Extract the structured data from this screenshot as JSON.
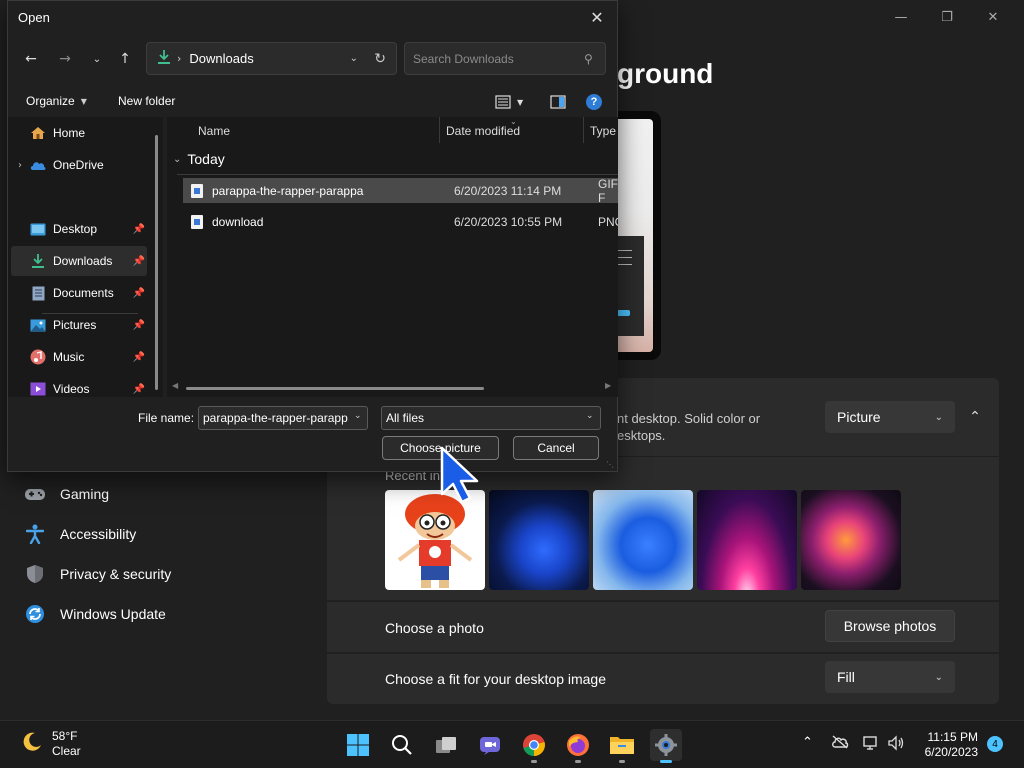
{
  "settings": {
    "title_fragment": "ground",
    "background_desc": "nt desktop. Solid color or\nesktops.",
    "personalize_type": "Picture",
    "recent_label": "Recent in",
    "photo_row_label": "Choose a photo",
    "browse_label": "Browse photos",
    "fit_row_label": "Choose a fit for your desktop image",
    "fit_value": "Fill",
    "nav": [
      {
        "label": "Gaming",
        "icon": "gaming-icon"
      },
      {
        "label": "Accessibility",
        "icon": "accessibility-icon"
      },
      {
        "label": "Privacy & security",
        "icon": "shield-icon"
      },
      {
        "label": "Windows Update",
        "icon": "windows-update-icon"
      }
    ]
  },
  "dialog": {
    "title": "Open",
    "address": "Downloads",
    "search_placeholder": "Search Downloads",
    "organize": "Organize",
    "new_folder": "New folder",
    "sidebar": [
      {
        "label": "Home",
        "icon": "home-icon",
        "expand": false,
        "pinned": false
      },
      {
        "label": "OneDrive",
        "icon": "onedrive-icon",
        "expand": true,
        "pinned": false
      },
      {
        "label": "Desktop",
        "icon": "desktop-icon",
        "pinned": true
      },
      {
        "label": "Downloads",
        "icon": "downloads-icon",
        "pinned": true,
        "active": true
      },
      {
        "label": "Documents",
        "icon": "documents-icon",
        "pinned": true
      },
      {
        "label": "Pictures",
        "icon": "pictures-icon",
        "pinned": true
      },
      {
        "label": "Music",
        "icon": "music-icon",
        "pinned": true
      },
      {
        "label": "Videos",
        "icon": "videos-icon",
        "pinned": true
      }
    ],
    "columns": {
      "name": "Name",
      "date": "Date modified",
      "type": "Type"
    },
    "group": "Today",
    "files": [
      {
        "name": "parappa-the-rapper-parappa",
        "date": "6/20/2023 11:14 PM",
        "type": "GIF F",
        "selected": true
      },
      {
        "name": "download",
        "date": "6/20/2023 10:55 PM",
        "type": "PNG",
        "selected": false
      }
    ],
    "file_name_label": "File name:",
    "file_name_value": "parappa-the-rapper-parapp",
    "file_type_value": "All files",
    "choose_label": "Choose picture",
    "cancel_label": "Cancel"
  },
  "taskbar": {
    "temp": "58°F",
    "condition": "Clear",
    "time": "11:15 PM",
    "date": "6/20/2023",
    "notif_count": "4",
    "apps": [
      "windows-start-icon",
      "search-icon",
      "task-view-icon",
      "teams-chat-icon",
      "chrome-icon",
      "firefox-icon",
      "file-explorer-icon",
      "settings-icon"
    ]
  },
  "colors": {
    "accent": "#4cc2ff",
    "background": "#202020",
    "card": "#2b2b2b"
  }
}
